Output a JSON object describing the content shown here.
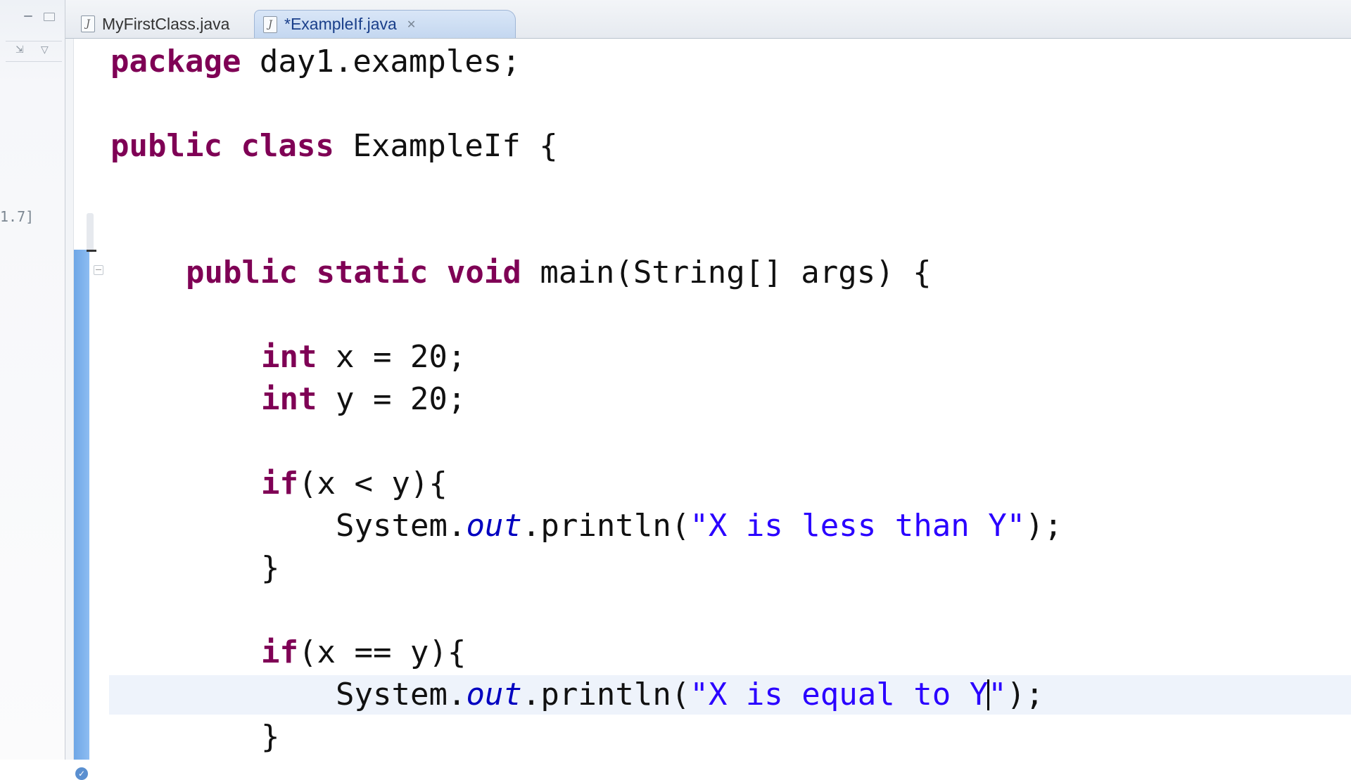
{
  "tabs": [
    {
      "label": "MyFirstClass.java",
      "active": false
    },
    {
      "label": "*ExampleIf.java",
      "active": true
    }
  ],
  "left_pane": {
    "partial_text": "1.7]"
  },
  "code": {
    "l1": {
      "kw": "package",
      "rest": " day1.examples;"
    },
    "l2": {
      "kw1": "public",
      "kw2": "class",
      "rest": " ExampleIf {"
    },
    "l3": {
      "kw1": "public",
      "kw2": "static",
      "kw3": "void",
      "rest": " main(String[] args) {"
    },
    "l4": {
      "kw": "int",
      "rest": " x = 20;"
    },
    "l5": {
      "kw": "int",
      "rest": " y = 20;"
    },
    "l6": {
      "kw": "if",
      "rest": "(x < y){"
    },
    "l7": {
      "a": "System.",
      "field": "out",
      "b": ".println(",
      "str": "\"X is less than Y\"",
      "c": ");"
    },
    "l8": {
      "text": "}"
    },
    "l9": {
      "kw": "if",
      "rest": "(x == y){"
    },
    "l10": {
      "a": "System.",
      "field": "out",
      "b": ".println(",
      "str1": "\"X is equal to Y",
      "str2": "\"",
      "c": ");"
    },
    "l11": {
      "text": "}"
    }
  },
  "colors": {
    "keyword": "#7f0055",
    "string": "#2a00ff",
    "field": "#0000c0",
    "current_line": "#eef3fb",
    "change_bar": "#6ea6e6"
  }
}
